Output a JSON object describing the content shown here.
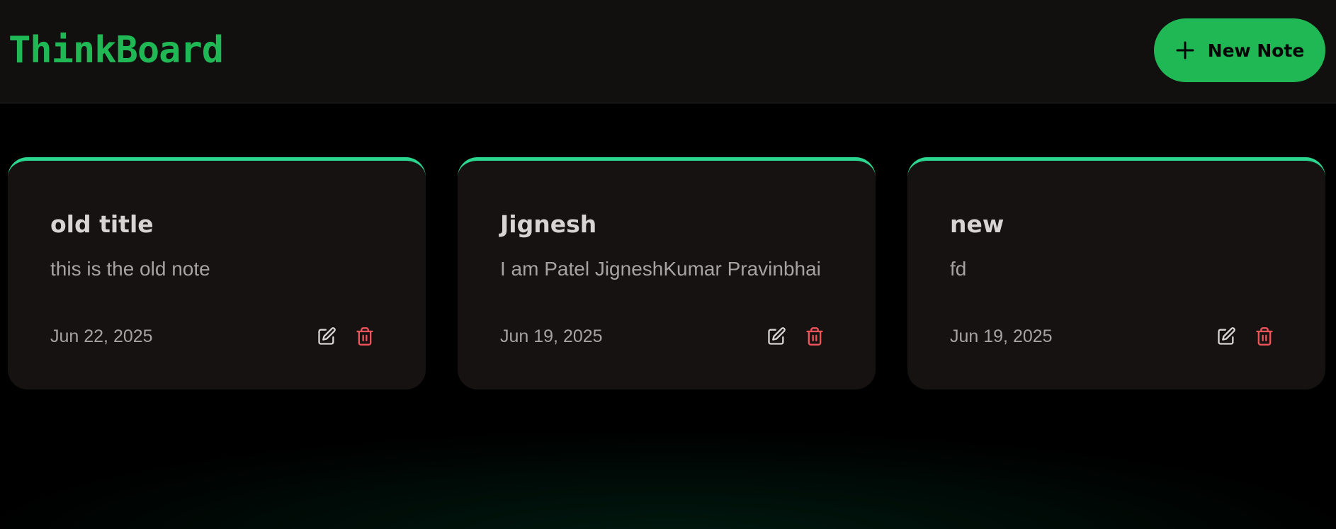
{
  "app": {
    "logo": "ThinkBoard",
    "brand_color": "#1fb854",
    "accent_color": "#2bd68f",
    "danger_color": "#f0535a"
  },
  "header": {
    "new_note_label": "New Note",
    "new_note_icon": "plus-icon"
  },
  "notes": [
    {
      "title": "old title",
      "content": "this is the old note",
      "date": "Jun 22, 2025",
      "edit_icon": "edit-icon",
      "delete_icon": "trash-icon"
    },
    {
      "title": "Jignesh",
      "content": "I am Patel JigneshKumar Pravinbhai",
      "date": "Jun 19, 2025",
      "edit_icon": "edit-icon",
      "delete_icon": "trash-icon"
    },
    {
      "title": "new",
      "content": "fd",
      "date": "Jun 19, 2025",
      "edit_icon": "edit-icon",
      "delete_icon": "trash-icon"
    }
  ]
}
